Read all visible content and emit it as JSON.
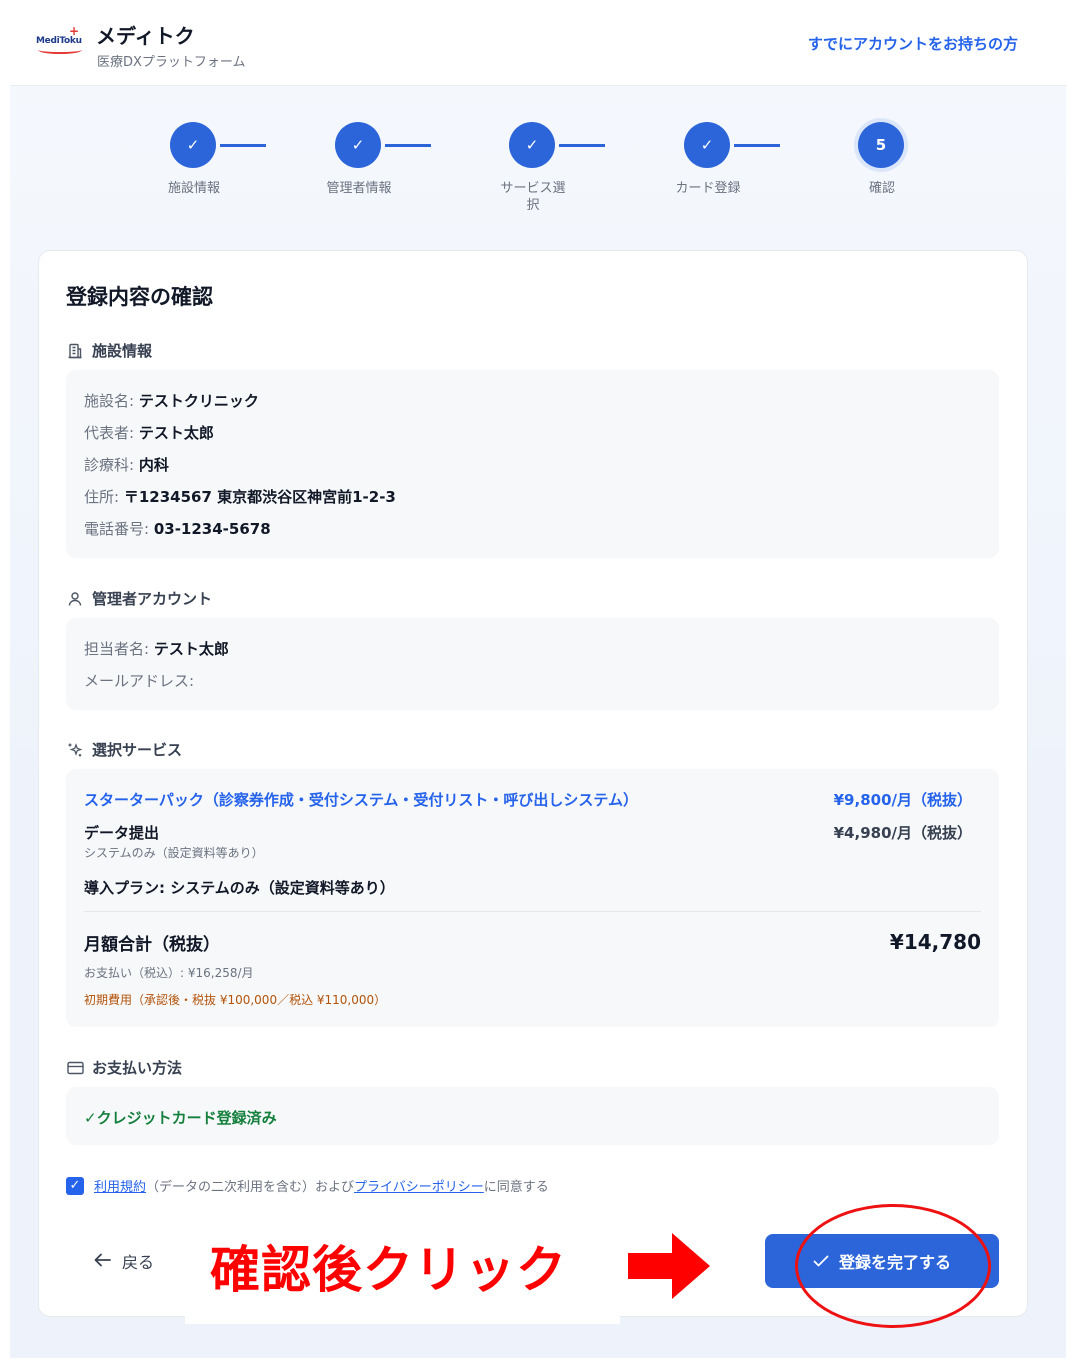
{
  "header": {
    "logo_text": "MediToku",
    "brand_name": "メディトク",
    "brand_sub": "医療DXプラットフォーム",
    "login_link": "すでにアカウントをお持ちの方"
  },
  "stepper": {
    "steps": [
      {
        "label": "施設情報",
        "state": "done"
      },
      {
        "label": "管理者情報",
        "state": "done"
      },
      {
        "label": "サービス選択",
        "label_line1": "サービス選",
        "label_line2": "択",
        "state": "done"
      },
      {
        "label": "カード登録",
        "state": "done"
      },
      {
        "label": "確認",
        "number": "5",
        "state": "current"
      }
    ],
    "done_glyph": "✓"
  },
  "card": {
    "title": "登録内容の確認",
    "facility": {
      "heading": "施設情報",
      "icon": "building-icon",
      "rows": [
        {
          "label": "施設名: ",
          "value": "テストクリニック"
        },
        {
          "label": "代表者: ",
          "value": "テスト太郎"
        },
        {
          "label": "診療科: ",
          "value": "内科"
        },
        {
          "label": "住所: ",
          "value": "〒1234567 東京都渋谷区神宮前1-2-3"
        },
        {
          "label": "電話番号: ",
          "value": "03-1234-5678"
        }
      ]
    },
    "admin": {
      "heading": "管理者アカウント",
      "icon": "user-icon",
      "rows": [
        {
          "label": "担当者名: ",
          "value": "テスト太郎"
        },
        {
          "label": "メールアドレス: ",
          "value": ""
        }
      ]
    },
    "services": {
      "heading": "選択サービス",
      "icon": "sparkle-icon",
      "starter_name": "スターターパック（診察券作成・受付システム・受付リスト・呼び出しシステム）",
      "starter_price": "¥9,800/月（税抜）",
      "data_name": "データ提出",
      "data_sub": "システムのみ（設定資料等あり）",
      "data_price": "¥4,980/月（税抜）",
      "plan": "導入プラン: システムのみ（設定資料等あり）",
      "total_label": "月額合計（税抜）",
      "total_value": "¥14,780",
      "pay_incl": "お支払い（税込）: ¥16,258/月",
      "initial_fee": "初期費用（承認後・税抜 ¥100,000／税込 ¥110,000）"
    },
    "payment": {
      "heading": "お支払い方法",
      "icon": "credit-card-icon",
      "status": "✓クレジットカード登録済み"
    },
    "agreement": {
      "checked": true,
      "terms_link": "利用規約",
      "middle": "（データの二次利用を含む）および",
      "privacy_link": "プライバシーポリシー",
      "tail": "に同意する"
    },
    "buttons": {
      "back": "戻る",
      "submit": "登録を完了する"
    }
  },
  "annotation": {
    "text": "確認後クリック",
    "color": "#ff0000"
  },
  "colors": {
    "primary": "#2b65d9",
    "link": "#2563eb",
    "success": "#15803d",
    "warning": "#b45309"
  }
}
